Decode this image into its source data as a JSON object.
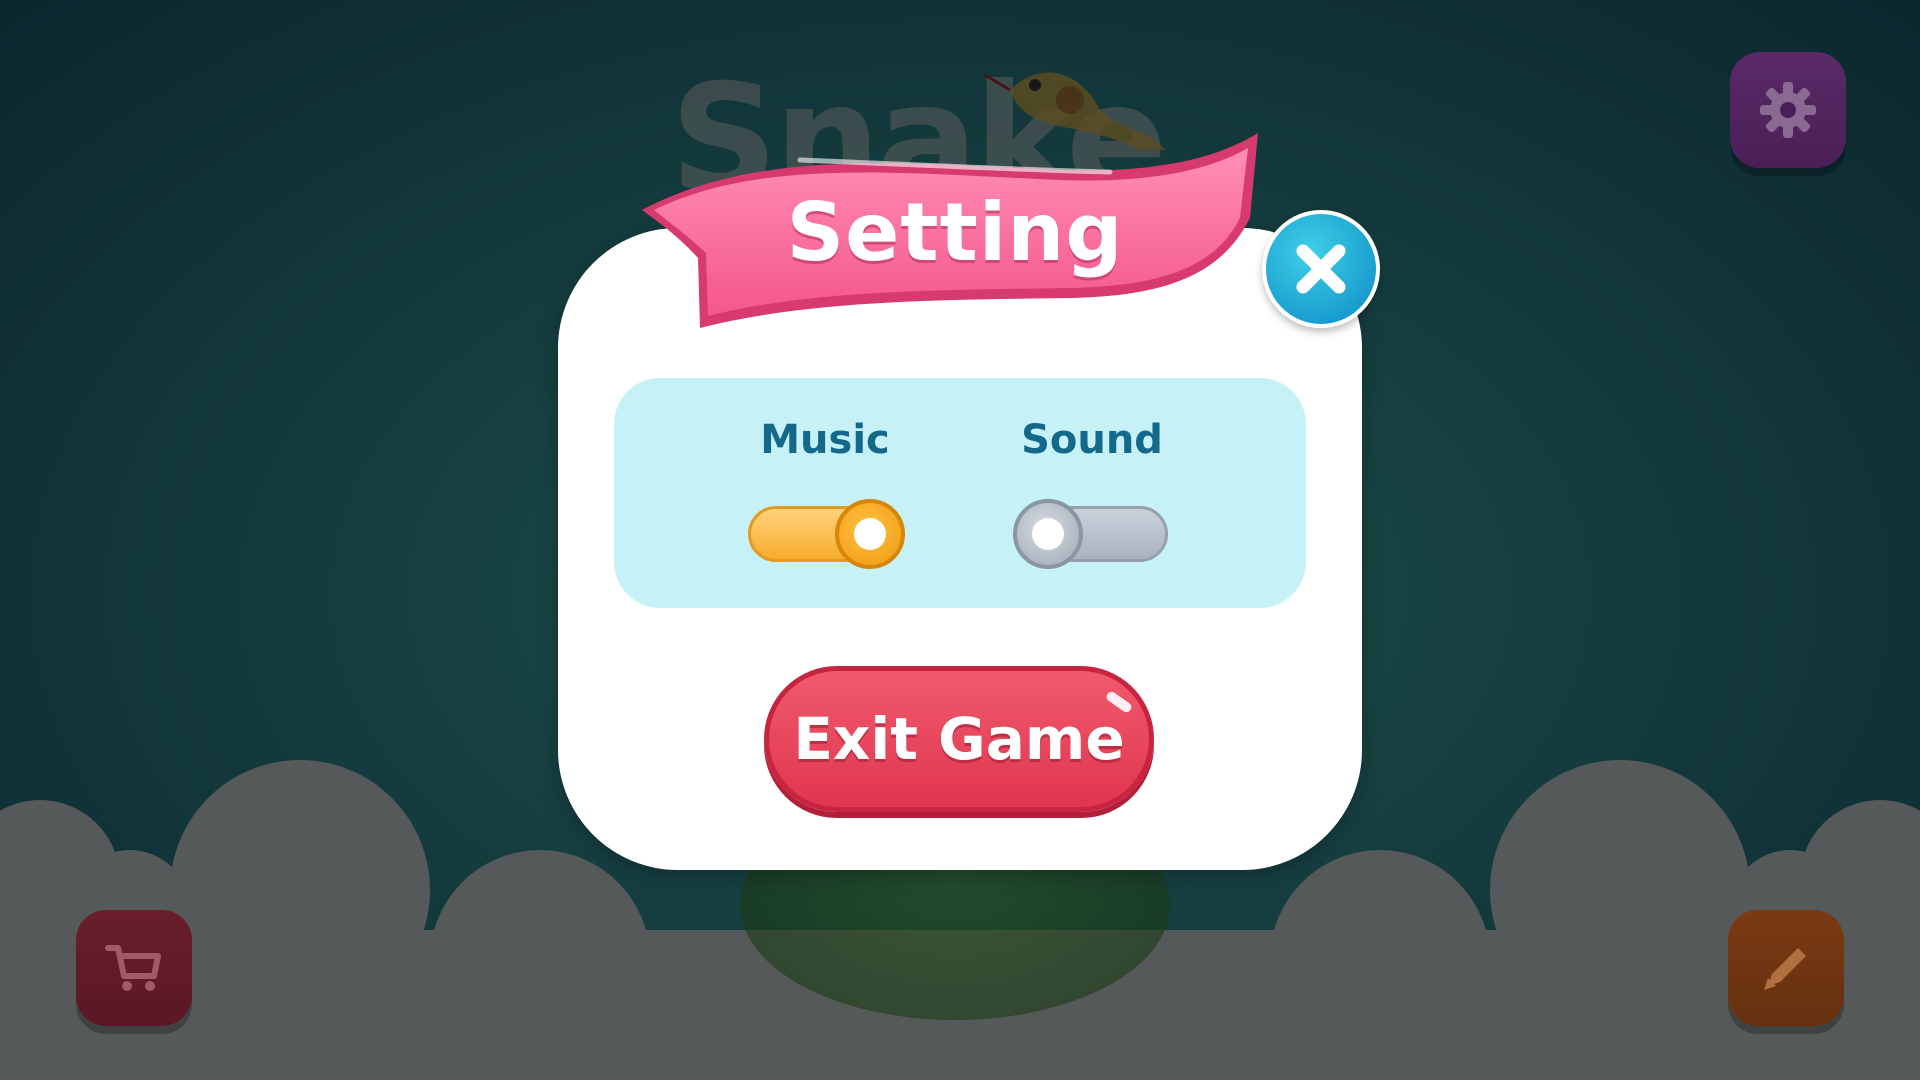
{
  "background": {
    "title_text": "Snake",
    "colors": {
      "sky_center": "#2f7a76",
      "sky_edge": "#123a45",
      "cloud": "#7c7c7c"
    }
  },
  "corner_buttons": {
    "settings": {
      "icon": "gear-icon",
      "color": "#5a2a66"
    },
    "shop": {
      "icon": "cart-icon",
      "color": "#6a1e2c"
    },
    "edit": {
      "icon": "pencil-icon",
      "color": "#7a3a13"
    }
  },
  "dialog": {
    "title": "Setting",
    "close_icon": "close-icon",
    "music": {
      "label": "Music",
      "state": "on"
    },
    "sound": {
      "label": "Sound",
      "state": "off"
    },
    "exit_button": "Exit Game",
    "colors": {
      "banner": "#ff6f9c",
      "panel": "#c6f2f7",
      "label": "#14688a",
      "toggle_on": "#f7ac2e",
      "toggle_off": "#a9b3bf",
      "exit": "#e0364f",
      "close": "#1a9fd0"
    }
  }
}
